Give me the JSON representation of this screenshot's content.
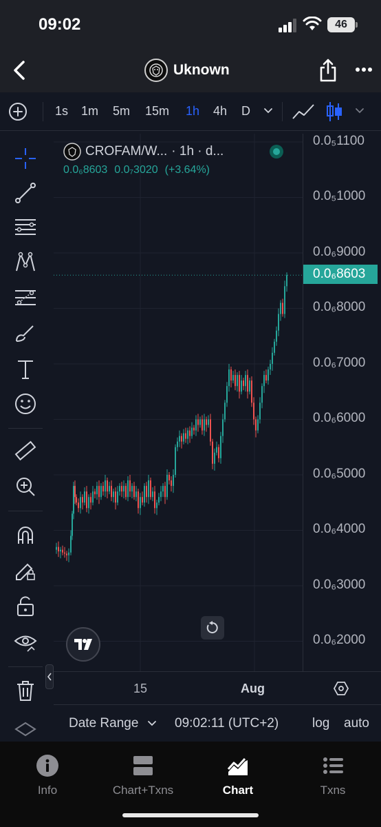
{
  "status_bar": {
    "time": "09:02",
    "battery": "46"
  },
  "nav": {
    "title": "Uknown"
  },
  "toolbar": {
    "timeframes": [
      "1s",
      "1m",
      "5m",
      "15m",
      "1h",
      "4h",
      "D"
    ],
    "active_timeframe": "1h"
  },
  "legend": {
    "symbol": "CROFAM/W...",
    "interval": "· 1h · d...",
    "price": "0.0₆8603",
    "change": "0.0₇3020",
    "change_pct": "(+3.64%)"
  },
  "price_axis": {
    "labels": [
      "0.0₅1100",
      "0.0₅1000",
      "0.0₆9000",
      "0.0₆8000",
      "0.0₆7000",
      "0.0₆6000",
      "0.0₆5000",
      "0.0₆4000",
      "0.0₆3000",
      "0.0₆2000"
    ],
    "current": "0.0₆8603"
  },
  "time_axis": {
    "labels": [
      "15",
      "Aug"
    ]
  },
  "bottom_bar": {
    "date_range": "Date Range",
    "clock": "09:02:11 (UTC+2)",
    "log": "log",
    "auto": "auto"
  },
  "tabs": [
    {
      "label": "Info",
      "icon": "info-icon"
    },
    {
      "label": "Chart+Txns",
      "icon": "chart-txns-icon"
    },
    {
      "label": "Chart",
      "icon": "chart-icon"
    },
    {
      "label": "Txns",
      "icon": "list-icon"
    }
  ],
  "active_tab": "Chart",
  "colors": {
    "accent": "#2962ff",
    "up": "#26a69a",
    "down": "#ef5350",
    "background": "#131722"
  },
  "chart_data": {
    "type": "candlestick",
    "scale": "log",
    "grid": true,
    "x_ticks": [
      "15",
      "Aug"
    ],
    "y_unit_note": "price ×10⁻⁶",
    "points": [
      [
        0,
        0.365
      ],
      [
        3,
        0.37
      ],
      [
        6,
        0.362
      ],
      [
        9,
        0.365
      ],
      [
        12,
        0.36
      ],
      [
        15,
        0.358
      ],
      [
        18,
        0.355
      ],
      [
        21,
        0.36
      ],
      [
        24,
        0.39
      ],
      [
        26,
        0.43
      ],
      [
        28,
        0.48
      ],
      [
        30,
        0.46
      ],
      [
        32,
        0.45
      ],
      [
        35,
        0.44
      ],
      [
        38,
        0.46
      ],
      [
        41,
        0.45
      ],
      [
        44,
        0.47
      ],
      [
        47,
        0.44
      ],
      [
        50,
        0.46
      ],
      [
        53,
        0.45
      ],
      [
        56,
        0.47
      ],
      [
        59,
        0.465
      ],
      [
        62,
        0.48
      ],
      [
        65,
        0.46
      ],
      [
        68,
        0.48
      ],
      [
        71,
        0.47
      ],
      [
        74,
        0.49
      ],
      [
        77,
        0.47
      ],
      [
        80,
        0.48
      ],
      [
        83,
        0.46
      ],
      [
        86,
        0.47
      ],
      [
        89,
        0.45
      ],
      [
        92,
        0.47
      ],
      [
        95,
        0.48
      ],
      [
        98,
        0.47
      ],
      [
        101,
        0.48
      ],
      [
        104,
        0.46
      ],
      [
        107,
        0.49
      ],
      [
        110,
        0.47
      ],
      [
        113,
        0.48
      ],
      [
        116,
        0.46
      ],
      [
        119,
        0.47
      ],
      [
        122,
        0.44
      ],
      [
        125,
        0.46
      ],
      [
        128,
        0.45
      ],
      [
        131,
        0.48
      ],
      [
        134,
        0.46
      ],
      [
        137,
        0.49
      ],
      [
        140,
        0.46
      ],
      [
        143,
        0.47
      ],
      [
        146,
        0.44
      ],
      [
        149,
        0.45
      ],
      [
        152,
        0.46
      ],
      [
        155,
        0.47
      ],
      [
        158,
        0.48
      ],
      [
        161,
        0.46
      ],
      [
        164,
        0.5
      ],
      [
        167,
        0.49
      ],
      [
        170,
        0.48
      ],
      [
        173,
        0.5
      ],
      [
        176,
        0.55
      ],
      [
        179,
        0.56
      ],
      [
        182,
        0.57
      ],
      [
        185,
        0.56
      ],
      [
        188,
        0.575
      ],
      [
        191,
        0.565
      ],
      [
        194,
        0.58
      ],
      [
        197,
        0.57
      ],
      [
        200,
        0.585
      ],
      [
        203,
        0.58
      ],
      [
        206,
        0.6
      ],
      [
        209,
        0.59
      ],
      [
        212,
        0.6
      ],
      [
        215,
        0.58
      ],
      [
        218,
        0.6
      ],
      [
        221,
        0.59
      ],
      [
        224,
        0.6
      ],
      [
        227,
        0.56
      ],
      [
        230,
        0.52
      ],
      [
        233,
        0.54
      ],
      [
        236,
        0.55
      ],
      [
        239,
        0.53
      ],
      [
        242,
        0.57
      ],
      [
        245,
        0.6
      ],
      [
        248,
        0.63
      ],
      [
        251,
        0.66
      ],
      [
        254,
        0.69
      ],
      [
        257,
        0.67
      ],
      [
        260,
        0.68
      ],
      [
        263,
        0.66
      ],
      [
        266,
        0.68
      ],
      [
        269,
        0.65
      ],
      [
        272,
        0.67
      ],
      [
        275,
        0.66
      ],
      [
        278,
        0.68
      ],
      [
        281,
        0.65
      ],
      [
        284,
        0.67
      ],
      [
        287,
        0.63
      ],
      [
        290,
        0.6
      ],
      [
        293,
        0.58
      ],
      [
        296,
        0.6
      ],
      [
        299,
        0.63
      ],
      [
        302,
        0.66
      ],
      [
        305,
        0.68
      ],
      [
        308,
        0.67
      ],
      [
        311,
        0.69
      ],
      [
        314,
        0.7
      ],
      [
        317,
        0.72
      ],
      [
        320,
        0.74
      ],
      [
        323,
        0.76
      ],
      [
        326,
        0.79
      ],
      [
        329,
        0.81
      ],
      [
        332,
        0.79
      ],
      [
        335,
        0.84
      ],
      [
        338,
        0.86
      ]
    ]
  }
}
